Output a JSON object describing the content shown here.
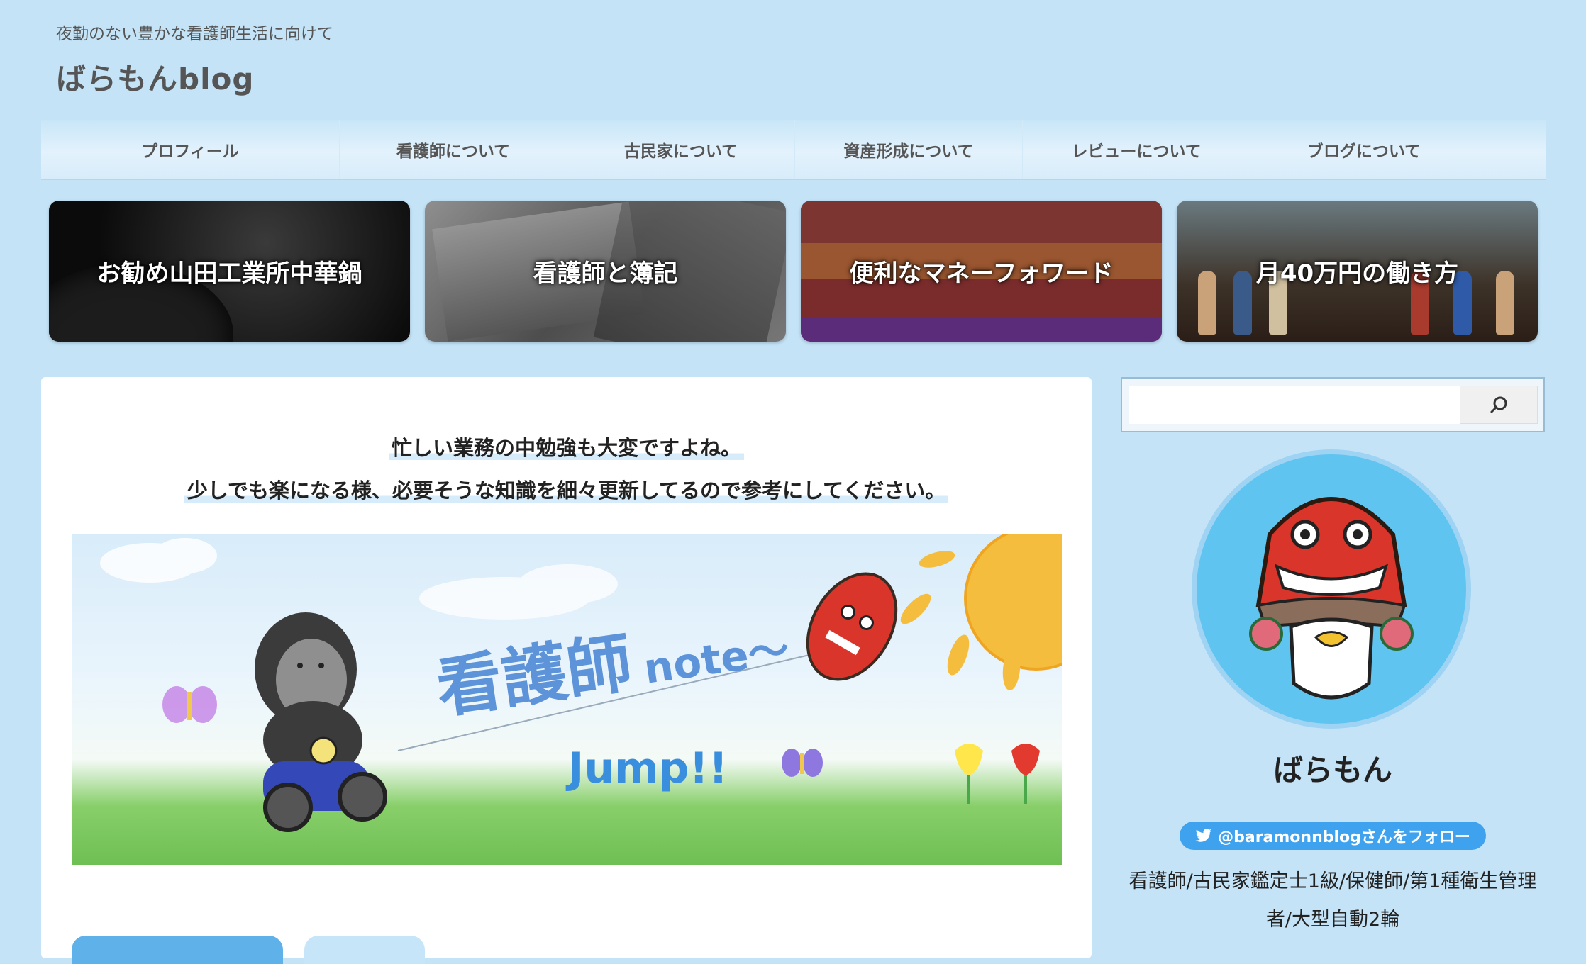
{
  "header": {
    "tagline": "夜勤のない豊かな看護師生活に向けて",
    "site_title": "ばらもんblog"
  },
  "nav": {
    "items": [
      {
        "label": "プロフィール"
      },
      {
        "label": "看護師について"
      },
      {
        "label": "古民家について"
      },
      {
        "label": "資産形成について"
      },
      {
        "label": "レビューについて"
      },
      {
        "label": "ブログについて"
      }
    ]
  },
  "featured": {
    "cards": [
      {
        "label": "お勧め山田工業所中華鍋"
      },
      {
        "label": "看護師と簿記"
      },
      {
        "label": "便利なマネーフォワード"
      },
      {
        "label": "月40万円の働き方"
      }
    ]
  },
  "main": {
    "intro_line1": "忙しい業務の中勉強も大変ですよね。",
    "intro_line2": "少しでも楽になる様、必要そうな知識を細々更新してるので参考にしてください。",
    "banner": {
      "title": "看護師",
      "title_suffix": "note〜",
      "jump": "Jump!!"
    }
  },
  "sidebar": {
    "search": {
      "placeholder": "",
      "icon": "search-icon"
    },
    "profile": {
      "name": "ばらもん",
      "follow_label": "@baramonnblogさんをフォロー",
      "bio": "看護師/古民家鑑定士1級/保健師/第1種衛生管理者/大型自動2輪"
    }
  },
  "colors": {
    "background": "#c4e3f7",
    "accent": "#3fa2ef"
  }
}
